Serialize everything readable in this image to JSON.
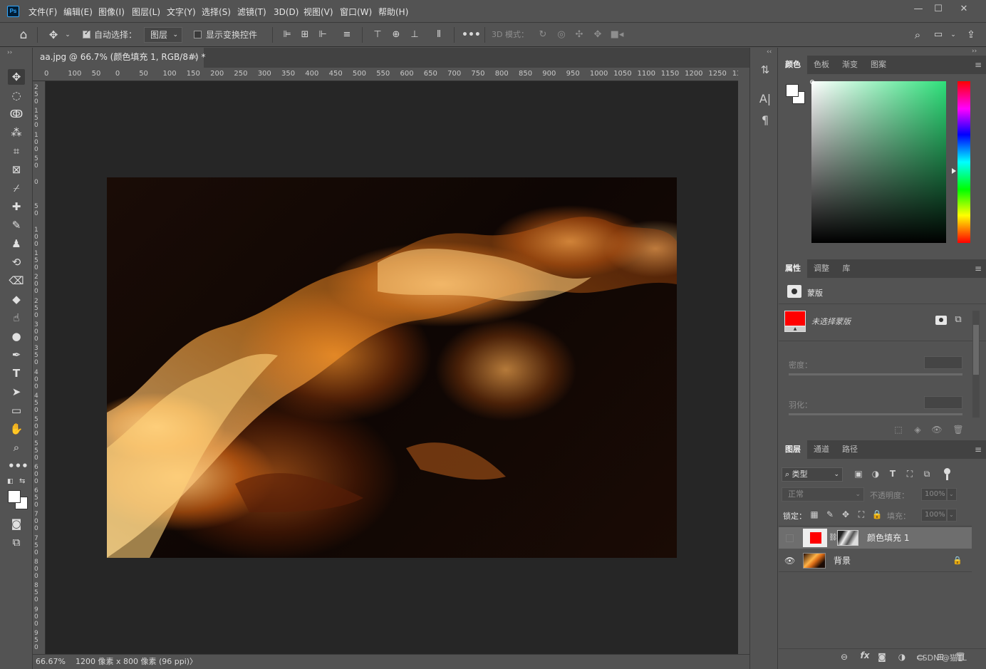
{
  "app": {
    "logo_text": "Ps"
  },
  "menu": [
    "文件(F)",
    "编辑(E)",
    "图像(I)",
    "图层(L)",
    "文字(Y)",
    "选择(S)",
    "滤镜(T)",
    "3D(D)",
    "视图(V)",
    "窗口(W)",
    "帮助(H)"
  ],
  "window_controls": {
    "minimize": "—",
    "restore": "☐",
    "close": "✕"
  },
  "options": {
    "auto_select_label": "自动选择：",
    "auto_select_checked": true,
    "auto_select_target": "图层",
    "show_transform_label": "显示变换控件",
    "show_transform_checked": false,
    "mode_3d_label": "3D 模式："
  },
  "document": {
    "tab_title": "aa.jpg @ 66.7% (颜色填充 1, RGB/8#) *",
    "tab_close": "×",
    "zoom": "66.67%",
    "doc_info": "1200 像素 x 800 像素 (96 ppi)",
    "status_arrow": "〉"
  },
  "ruler": {
    "h_labels": [
      "0",
      "100",
      "50",
      "0",
      "50",
      "100",
      "150",
      "200",
      "250",
      "300",
      "350",
      "400",
      "450",
      "500",
      "550",
      "600",
      "650",
      "700",
      "750",
      "800",
      "850",
      "900",
      "950",
      "1000",
      "1050",
      "1100",
      "1150",
      "1200",
      "1250",
      "130"
    ],
    "v_labels": [
      "250",
      "150",
      "100",
      "50",
      "0",
      "50",
      "100",
      "150",
      "200",
      "250",
      "300",
      "350",
      "400",
      "450",
      "500",
      "550",
      "600",
      "650",
      "700",
      "750",
      "800",
      "850",
      "900",
      "950"
    ]
  },
  "color_panel": {
    "tabs": [
      "颜色",
      "色板",
      "渐变",
      "图案"
    ],
    "active_tab": 0,
    "hue_color": "#2ee07a"
  },
  "properties_panel": {
    "tabs": [
      "属性",
      "调整",
      "库"
    ],
    "active_tab": 0,
    "mask_label": "蒙版",
    "no_mask_text": "未选择蒙版",
    "density_label": "密度：",
    "feather_label": "羽化："
  },
  "layers_panel": {
    "tabs": [
      "图层",
      "通道",
      "路径"
    ],
    "active_tab": 0,
    "filter_label": "类型",
    "blend_mode": "正常",
    "opacity_label": "不透明度：",
    "opacity_value": "100%",
    "lock_label": "锁定：",
    "fill_label": "填充：",
    "fill_value": "100%",
    "layers": [
      {
        "name": "颜色填充 1",
        "visible": false,
        "selected": true,
        "fill_color": "#ff0000"
      },
      {
        "name": "背景",
        "visible": true,
        "selected": false,
        "locked": true
      }
    ],
    "footer_icons": [
      "link-icon",
      "fx-icon",
      "mask-icon",
      "adjustment-icon",
      "folder-icon",
      "new-layer-icon",
      "trash-icon"
    ],
    "fx_label": "fx"
  },
  "watermark": "CSDN @猫TL"
}
